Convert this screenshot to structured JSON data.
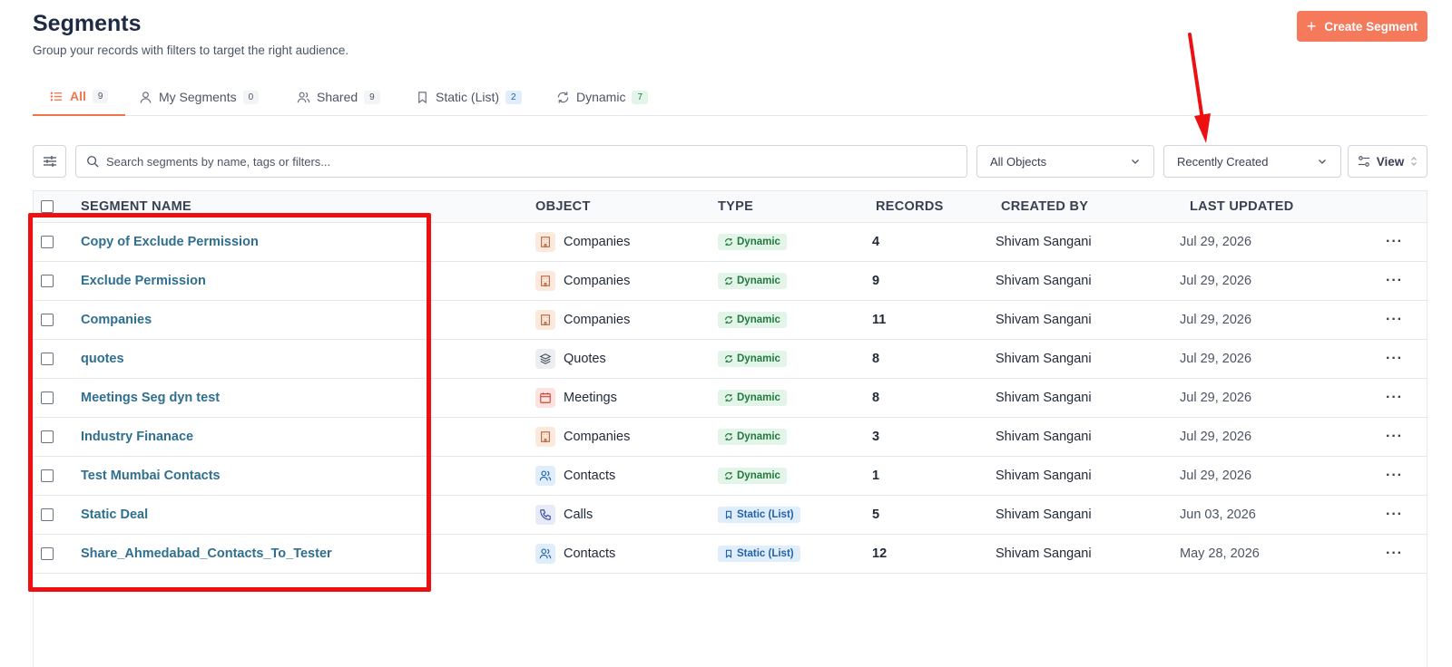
{
  "header": {
    "title": "Segments",
    "subtitle": "Group your records with filters to target the right audience.",
    "create_label": "Create Segment"
  },
  "tabs": [
    {
      "label": "All",
      "count": "9",
      "active": true
    },
    {
      "label": "My Segments",
      "count": "0"
    },
    {
      "label": "Shared",
      "count": "9"
    },
    {
      "label": "Static (List)",
      "count": "2"
    },
    {
      "label": "Dynamic",
      "count": "7"
    }
  ],
  "toolbar": {
    "search_placeholder": "Search segments by name, tags or filters...",
    "object_filter": "All Objects",
    "sort": "Recently Created",
    "view_label": "View"
  },
  "table": {
    "columns": [
      "SEGMENT NAME",
      "OBJECT",
      "TYPE",
      "RECORDS",
      "CREATED BY",
      "LAST UPDATED"
    ],
    "rows": [
      {
        "name": "Copy of Exclude Permission",
        "object": "Companies",
        "object_icon": "building-icon",
        "type": "Dynamic",
        "records": "4",
        "created_by": "Shivam Sangani",
        "last_updated": "Jul 29, 2026"
      },
      {
        "name": "Exclude Permission",
        "object": "Companies",
        "object_icon": "building-icon",
        "type": "Dynamic",
        "records": "9",
        "created_by": "Shivam Sangani",
        "last_updated": "Jul 29, 2026"
      },
      {
        "name": "Companies",
        "object": "Companies",
        "object_icon": "building-icon",
        "type": "Dynamic",
        "records": "11",
        "created_by": "Shivam Sangani",
        "last_updated": "Jul 29, 2026"
      },
      {
        "name": "quotes",
        "object": "Quotes",
        "object_icon": "layers-icon",
        "type": "Dynamic",
        "records": "8",
        "created_by": "Shivam Sangani",
        "last_updated": "Jul 29, 2026"
      },
      {
        "name": "Meetings Seg dyn test",
        "object": "Meetings",
        "object_icon": "calendar-icon",
        "type": "Dynamic",
        "records": "8",
        "created_by": "Shivam Sangani",
        "last_updated": "Jul 29, 2026"
      },
      {
        "name": "Industry Finanace",
        "object": "Companies",
        "object_icon": "building-icon",
        "type": "Dynamic",
        "records": "3",
        "created_by": "Shivam Sangani",
        "last_updated": "Jul 29, 2026"
      },
      {
        "name": "Test Mumbai Contacts",
        "object": "Contacts",
        "object_icon": "users-icon",
        "type": "Dynamic",
        "records": "1",
        "created_by": "Shivam Sangani",
        "last_updated": "Jul 29, 2026"
      },
      {
        "name": "Static Deal",
        "object": "Calls",
        "object_icon": "phone-icon",
        "type": "Static (List)",
        "records": "5",
        "created_by": "Shivam Sangani",
        "last_updated": "Jun 03, 2026"
      },
      {
        "name": "Share_Ahmedabad_Contacts_To_Tester",
        "object": "Contacts",
        "object_icon": "users-icon",
        "type": "Static (List)",
        "records": "12",
        "created_by": "Shivam Sangani",
        "last_updated": "May 28, 2026"
      }
    ]
  },
  "colors": {
    "accent": "#f47a5b",
    "link": "#2f6f8f",
    "dynamic_badge": "#237a3f",
    "static_badge": "#2563a8",
    "annotation": "#ee1010"
  }
}
